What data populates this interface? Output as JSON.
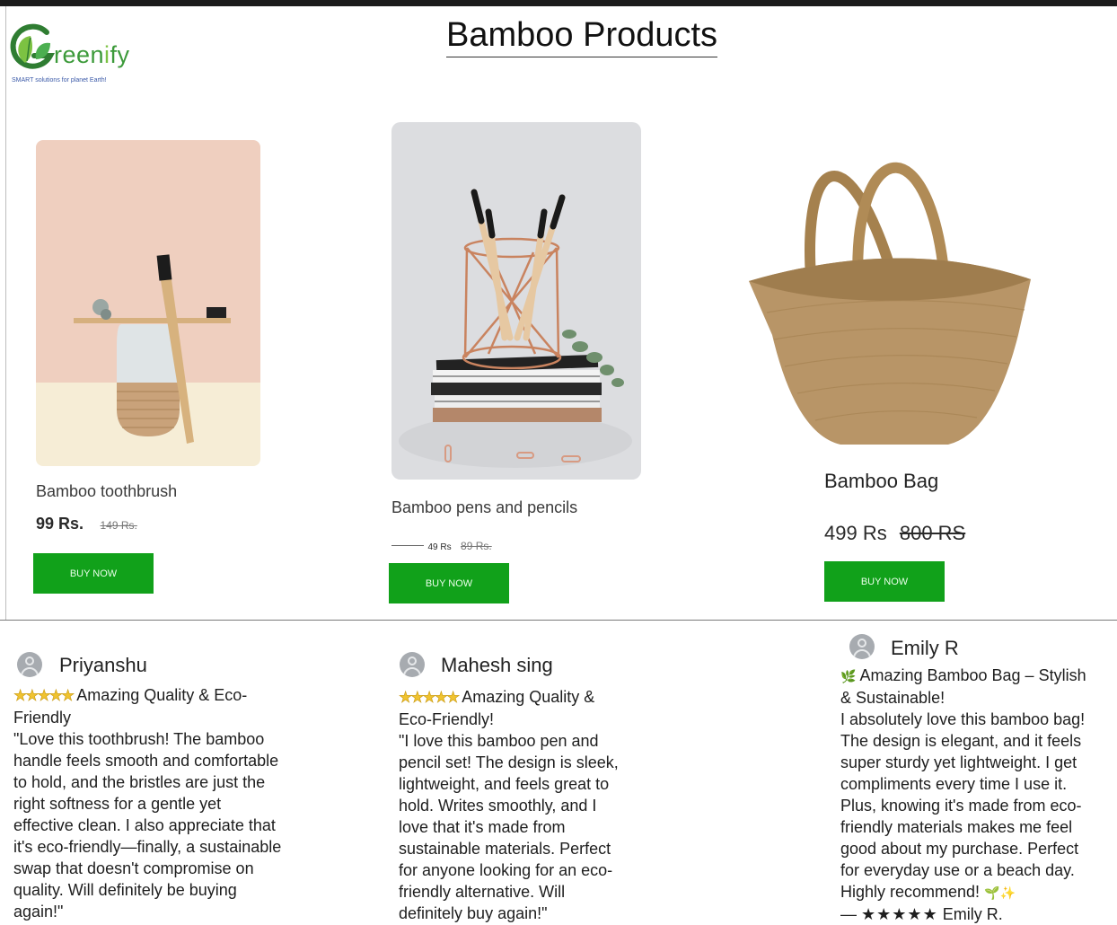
{
  "brand": {
    "name_first_letter": "G",
    "name_rest": "reen",
    "name_i": "i",
    "name_end": "fy",
    "tagline": "SMART solutions for planet Earth!"
  },
  "page_title": "Bamboo Products",
  "products": [
    {
      "name": "Bamboo toothbrush",
      "price": "99 Rs.",
      "old_price": "149 Rs.",
      "button": "BUY NOW"
    },
    {
      "name": "Bamboo pens and pencils",
      "price": "49 Rs",
      "old_price": "89 Rs.",
      "button": "BUY NOW"
    },
    {
      "name": "Bamboo Bag",
      "price": "499 Rs",
      "old_price": "800 RS",
      "button": "BUY NOW"
    }
  ],
  "reviews": [
    {
      "name": "Priyanshu",
      "stars": "★★★★★",
      "headline": "Amazing Quality & Eco-Friendly",
      "body": "\"Love this toothbrush! The bamboo handle feels smooth and comfortable to hold, and the bristles are just the right softness for a gentle yet effective clean. I also appreciate that it's eco-friendly—finally, a sustainable swap that doesn't compromise on quality. Will definitely be buying again!\""
    },
    {
      "name": "Mahesh sing",
      "stars": "★★★★★",
      "headline": "Amazing Quality & Eco-Friendly!",
      "body": "\"I love this bamboo pen and pencil set! The design is sleek, lightweight, and feels great to hold. Writes smoothly, and I love that it's made from sustainable materials. Perfect for anyone looking for an eco-friendly alternative. Will definitely buy again!\""
    },
    {
      "name": "Emily R",
      "headline_emoji": "🌿",
      "headline": "Amazing Bamboo Bag – Stylish & Sustainable!",
      "body": "I absolutely love this bamboo bag! The design is elegant, and it feels super sturdy yet lightweight. I get compliments every time I use it. Plus, knowing it's made from eco-friendly materials makes me feel good about my purchase. Perfect for everyday use or a beach day. Highly recommend!",
      "body_emoji": "🌱✨",
      "signature_prefix": "— ",
      "signature_stars": "★★★★★",
      "signature_name": "Emily R."
    }
  ],
  "colors": {
    "buy_button": "#11a11a",
    "brand_green": "#3c9a3a"
  }
}
